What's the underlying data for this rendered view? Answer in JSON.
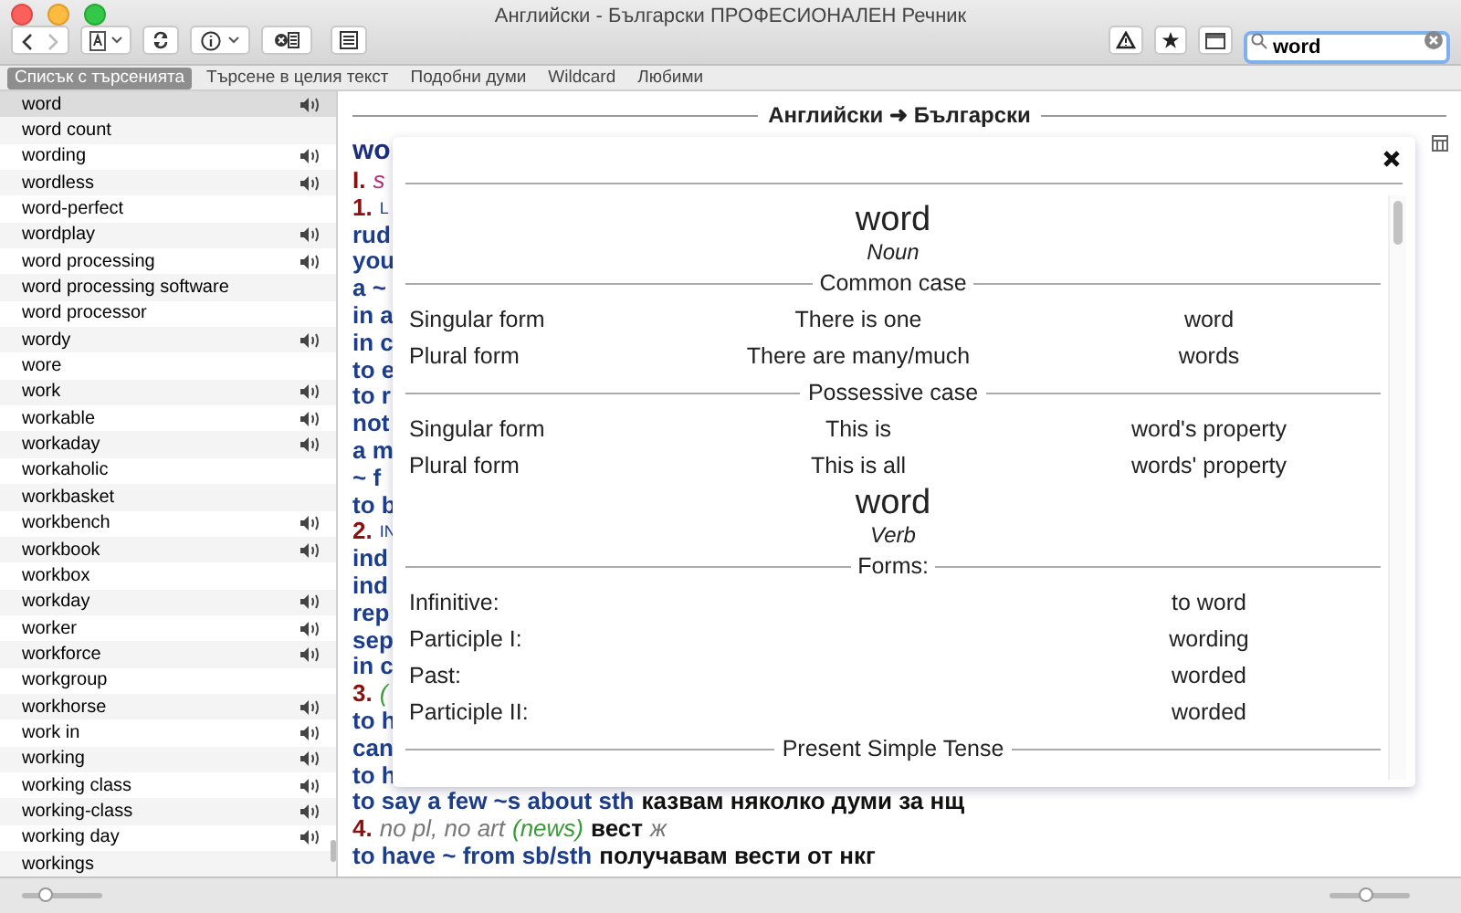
{
  "window": {
    "title": "Английски - Български ПРОФЕСИОНАЛЕН Речник"
  },
  "search": {
    "value": "word"
  },
  "tabs": [
    {
      "label": "Списък с търсенията",
      "selected": true
    },
    {
      "label": "Търсене в целия текст",
      "selected": false
    },
    {
      "label": "Подобни думи",
      "selected": false
    },
    {
      "label": "Wildcard",
      "selected": false
    },
    {
      "label": "Любими",
      "selected": false
    }
  ],
  "word_list": [
    {
      "text": "word",
      "audio": true,
      "selected": true
    },
    {
      "text": "word count",
      "audio": false,
      "selected": false
    },
    {
      "text": "wording",
      "audio": true,
      "selected": false
    },
    {
      "text": "wordless",
      "audio": true,
      "selected": false
    },
    {
      "text": "word-perfect",
      "audio": false,
      "selected": false
    },
    {
      "text": "wordplay",
      "audio": true,
      "selected": false
    },
    {
      "text": "word processing",
      "audio": true,
      "selected": false
    },
    {
      "text": "word processing software",
      "audio": false,
      "selected": false
    },
    {
      "text": "word processor",
      "audio": false,
      "selected": false
    },
    {
      "text": "wordy",
      "audio": true,
      "selected": false
    },
    {
      "text": "wore",
      "audio": false,
      "selected": false
    },
    {
      "text": "work",
      "audio": true,
      "selected": false
    },
    {
      "text": "workable",
      "audio": true,
      "selected": false
    },
    {
      "text": "workaday",
      "audio": true,
      "selected": false
    },
    {
      "text": "workaholic",
      "audio": false,
      "selected": false
    },
    {
      "text": "workbasket",
      "audio": false,
      "selected": false
    },
    {
      "text": "workbench",
      "audio": true,
      "selected": false
    },
    {
      "text": "workbook",
      "audio": true,
      "selected": false
    },
    {
      "text": "workbox",
      "audio": false,
      "selected": false
    },
    {
      "text": "workday",
      "audio": true,
      "selected": false
    },
    {
      "text": "worker",
      "audio": true,
      "selected": false
    },
    {
      "text": "workforce",
      "audio": true,
      "selected": false
    },
    {
      "text": "workgroup",
      "audio": false,
      "selected": false
    },
    {
      "text": "workhorse",
      "audio": true,
      "selected": false
    },
    {
      "text": "work in",
      "audio": true,
      "selected": false
    },
    {
      "text": "working",
      "audio": true,
      "selected": false
    },
    {
      "text": "working class",
      "audio": true,
      "selected": false
    },
    {
      "text": "working-class",
      "audio": true,
      "selected": false
    },
    {
      "text": "working day",
      "audio": true,
      "selected": false
    },
    {
      "text": "workings",
      "audio": false,
      "selected": false
    }
  ],
  "article": {
    "header": "Английски ➜ Български",
    "lines": [
      [
        {
          "kind": "headword",
          "text": "wo"
        }
      ],
      [
        {
          "kind": "number",
          "text": "I."
        },
        {
          "kind": "label",
          "text": "s"
        }
      ],
      [
        {
          "kind": "number",
          "text": "1."
        },
        {
          "kind": "small",
          "text": "L"
        }
      ],
      [
        {
          "kind": "phrase",
          "text": "rud"
        }
      ],
      [
        {
          "kind": "phrase",
          "text": "you"
        }
      ],
      [
        {
          "kind": "phrase",
          "text": "a ~"
        }
      ],
      [
        {
          "kind": "phrase",
          "text": "in a"
        }
      ],
      [
        {
          "kind": "phrase",
          "text": "in c"
        }
      ],
      [
        {
          "kind": "phrase",
          "text": "to e"
        }
      ],
      [
        {
          "kind": "phrase",
          "text": "to r"
        }
      ],
      [
        {
          "kind": "phrase",
          "text": "not"
        }
      ],
      [
        {
          "kind": "phrase",
          "text": "a m"
        }
      ],
      [
        {
          "kind": "phrase",
          "text": "~ f"
        }
      ],
      [
        {
          "kind": "phrase",
          "text": "to b"
        }
      ],
      [
        {
          "kind": "number",
          "text": "2."
        },
        {
          "kind": "small",
          "text": "IN"
        }
      ],
      [
        {
          "kind": "phrase",
          "text": "ind"
        }
      ],
      [
        {
          "kind": "phrase",
          "text": "ind"
        }
      ],
      [
        {
          "kind": "phrase",
          "text": "rep"
        }
      ],
      [
        {
          "kind": "phrase",
          "text": "sep"
        }
      ],
      [
        {
          "kind": "phrase",
          "text": "in c"
        }
      ],
      [
        {
          "kind": "number",
          "text": "3."
        },
        {
          "kind": "note",
          "text": "("
        }
      ],
      [
        {
          "kind": "phrase",
          "text": "to h"
        }
      ],
      [
        {
          "kind": "phrase",
          "text": "can"
        }
      ],
      [
        {
          "kind": "phrase",
          "text": "to h"
        }
      ],
      [
        {
          "kind": "phrase",
          "text": "to say a few ~s about sth"
        },
        {
          "kind": "translation",
          "text": "казвам няколко думи за нщ"
        }
      ],
      [
        {
          "kind": "number",
          "text": "4."
        },
        {
          "kind": "gram",
          "text": "no pl, no art"
        },
        {
          "kind": "note",
          "text": "(news)"
        },
        {
          "kind": "translation",
          "text": "вест"
        },
        {
          "kind": "gram",
          "text": "ж"
        }
      ],
      [
        {
          "kind": "phrase",
          "text": "to have ~ from sb/sth"
        },
        {
          "kind": "translation",
          "text": "получавам вести от нкг"
        }
      ]
    ]
  },
  "popup": {
    "blocks": [
      {
        "kind": "headword",
        "word": "word",
        "pos": "Noun"
      },
      {
        "kind": "section",
        "title": "Common case"
      },
      {
        "kind": "row",
        "label": "Singular form",
        "middle": "There is one",
        "value": "word"
      },
      {
        "kind": "row",
        "label": "Plural form",
        "middle": "There are many/much",
        "value": "words"
      },
      {
        "kind": "section",
        "title": "Possessive case"
      },
      {
        "kind": "row",
        "label": "Singular form",
        "middle": "This is",
        "value": "word's property"
      },
      {
        "kind": "row",
        "label": "Plural form",
        "middle": "This is all",
        "value": "words' property"
      },
      {
        "kind": "headword",
        "word": "word",
        "pos": "Verb"
      },
      {
        "kind": "section",
        "title": "Forms:"
      },
      {
        "kind": "row",
        "label": "Infinitive:",
        "value": "to word"
      },
      {
        "kind": "row",
        "label": "Participle I:",
        "value": "wording"
      },
      {
        "kind": "row",
        "label": "Past:",
        "value": "worded"
      },
      {
        "kind": "row",
        "label": "Participle II:",
        "value": "worded"
      },
      {
        "kind": "section",
        "title": "Present Simple Tense"
      }
    ]
  },
  "bottom_bar": {
    "sliders": [
      {
        "level": 0.25
      },
      {
        "level": 0.45
      }
    ]
  }
}
